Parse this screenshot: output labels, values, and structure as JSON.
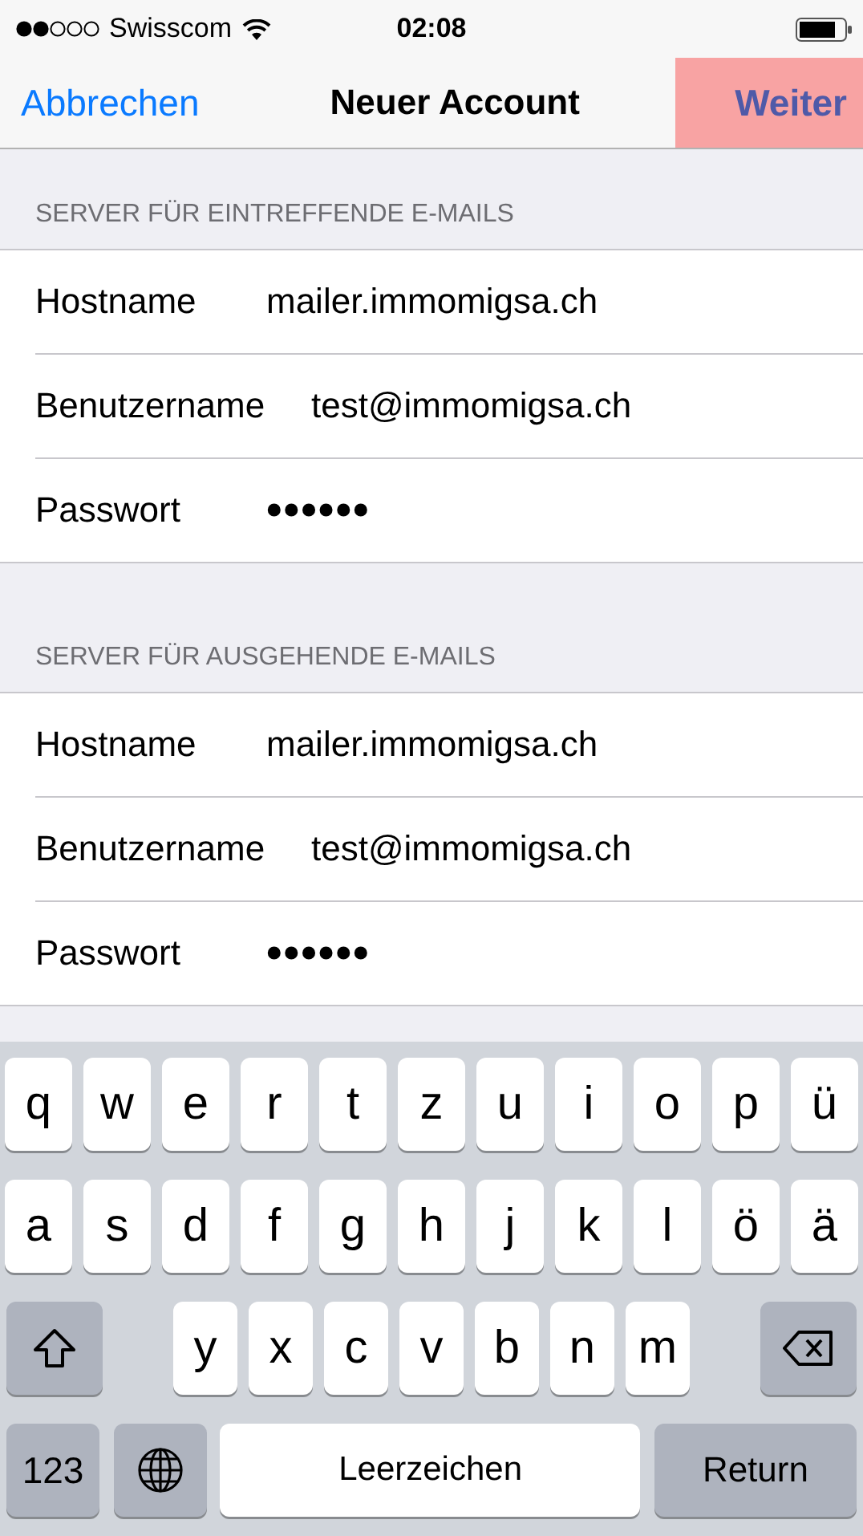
{
  "status_bar": {
    "carrier": "Swisscom",
    "time": "02:08"
  },
  "nav": {
    "cancel": "Abbrechen",
    "title": "Neuer Account",
    "next": {
      "label": "Weiter",
      "highlighted": true
    }
  },
  "sections": [
    {
      "header": "SERVER FÜR EINTREFFENDE E-MAILS",
      "rows": [
        {
          "label": "Hostname",
          "value": "mailer.immomigsa.ch"
        },
        {
          "label": "Benutzername",
          "value": "test@immomigsa.ch"
        },
        {
          "label": "Passwort",
          "value": "••••••"
        }
      ]
    },
    {
      "header": "SERVER FÜR AUSGEHENDE E-MAILS",
      "rows": [
        {
          "label": "Hostname",
          "value": "mailer.immomigsa.ch"
        },
        {
          "label": "Benutzername",
          "value": "test@immomigsa.ch"
        },
        {
          "label": "Passwort",
          "value": "••••••"
        }
      ]
    }
  ],
  "keyboard": {
    "top_letters": [
      "q",
      "w",
      "e",
      "r",
      "t",
      "z",
      "u",
      "i",
      "o",
      "p",
      "ü"
    ],
    "home_letters": [
      "a",
      "s",
      "d",
      "f",
      "g",
      "h",
      "j",
      "k",
      "l",
      "ö",
      "ä"
    ],
    "bottom_letters": [
      "y",
      "x",
      "c",
      "v",
      "b",
      "n",
      "m"
    ],
    "function_keys": [
      {
        "kind": "numbers",
        "label": "123"
      },
      {
        "kind": "globe"
      },
      {
        "kind": "space",
        "label": "Leerzeichen"
      },
      {
        "kind": "return",
        "label": "Return"
      }
    ]
  }
}
